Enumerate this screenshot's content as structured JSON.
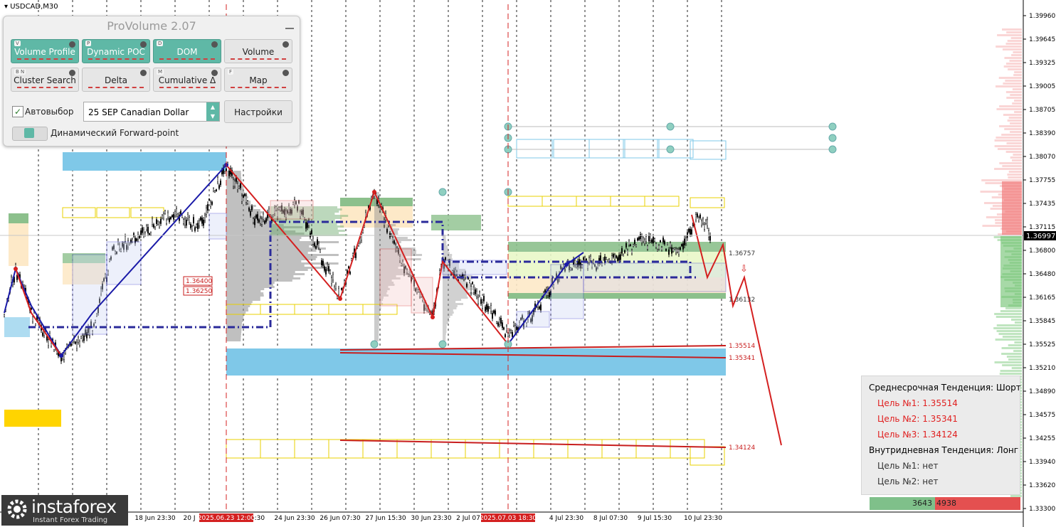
{
  "symbol": "USDCAD,M30",
  "panel": {
    "title": "ProVolume 2.07",
    "buttons": [
      {
        "label": "Volume Profile",
        "key": "V",
        "active": true
      },
      {
        "label": "Dynamic POC",
        "key": "P",
        "active": true
      },
      {
        "label": "DOM",
        "key": "D",
        "active": true
      },
      {
        "label": "Volume",
        "key": "",
        "active": false
      },
      {
        "label": "Cluster Search",
        "key": "B N",
        "active": false
      },
      {
        "label": "Delta",
        "key": "",
        "active": false
      },
      {
        "label": "Cumulative Δ",
        "key": "M",
        "active": false
      },
      {
        "label": "Map",
        "key": "F",
        "active": false
      }
    ],
    "autoselect_label": "Автовыбор",
    "autoselect_checked": true,
    "contract": "25 SEP Canadian Dollar",
    "settings_label": "Настройки",
    "forward_point_label": "Динамический Forward-point"
  },
  "price_axis": {
    "labels": [
      "1.39960",
      "1.39645",
      "1.39325",
      "1.39005",
      "1.38705",
      "1.38390",
      "1.38070",
      "1.37755",
      "1.37435",
      "1.37115",
      "1.36800",
      "1.36480",
      "1.36165",
      "1.35845",
      "1.35525",
      "1.35210",
      "1.34890",
      "1.34575",
      "1.34255",
      "1.33940",
      "1.33620",
      "1.33300"
    ],
    "current_price": "1.36997"
  },
  "time_axis": {
    "labels": [
      "18 Jun 23:30",
      "20 J",
      "5:30",
      "24 Jun 23:30",
      "26 Jun 07:30",
      "27 Jun 15:30",
      "30 Jun 23:30",
      "2 Jul 07",
      "4 Jul 23:30",
      "8 Jul 07:30",
      "9 Jul 15:30",
      "10 Jul 23:30"
    ],
    "highlighted": [
      "2025.06.23 12:00",
      "2025.07.03 18:30"
    ]
  },
  "level_labels": {
    "l1": "1.36757",
    "l2": "1.36132",
    "l3": "1.35514",
    "l4": "1.35341",
    "l5": "1.34124",
    "box1": "1.36400",
    "box2": "1.36250"
  },
  "info": {
    "mid_trend": "Среднесрочная Тенденция: Шорт",
    "target1": "Цель №1: 1.35514",
    "target2": "Цель №2: 1.35341",
    "target3": "Цель №3: 1.34124",
    "intra_trend": "Внутридневная Тенденция: Лонг",
    "intra1": "Цель №1: нет",
    "intra2": "Цель №2: нет"
  },
  "volumes": {
    "buy": "3643",
    "sell": "4938"
  },
  "logo": {
    "name": "instaforex",
    "tagline": "Instant Forex Trading"
  },
  "colors": {
    "bull_line": "#1a1aa8",
    "bear_line": "#d42020",
    "zone_blue": "#7fc8e8",
    "zone_green": "#6aa86a",
    "zone_yellow": "#ffd400",
    "accent": "#5fb8a6"
  }
}
